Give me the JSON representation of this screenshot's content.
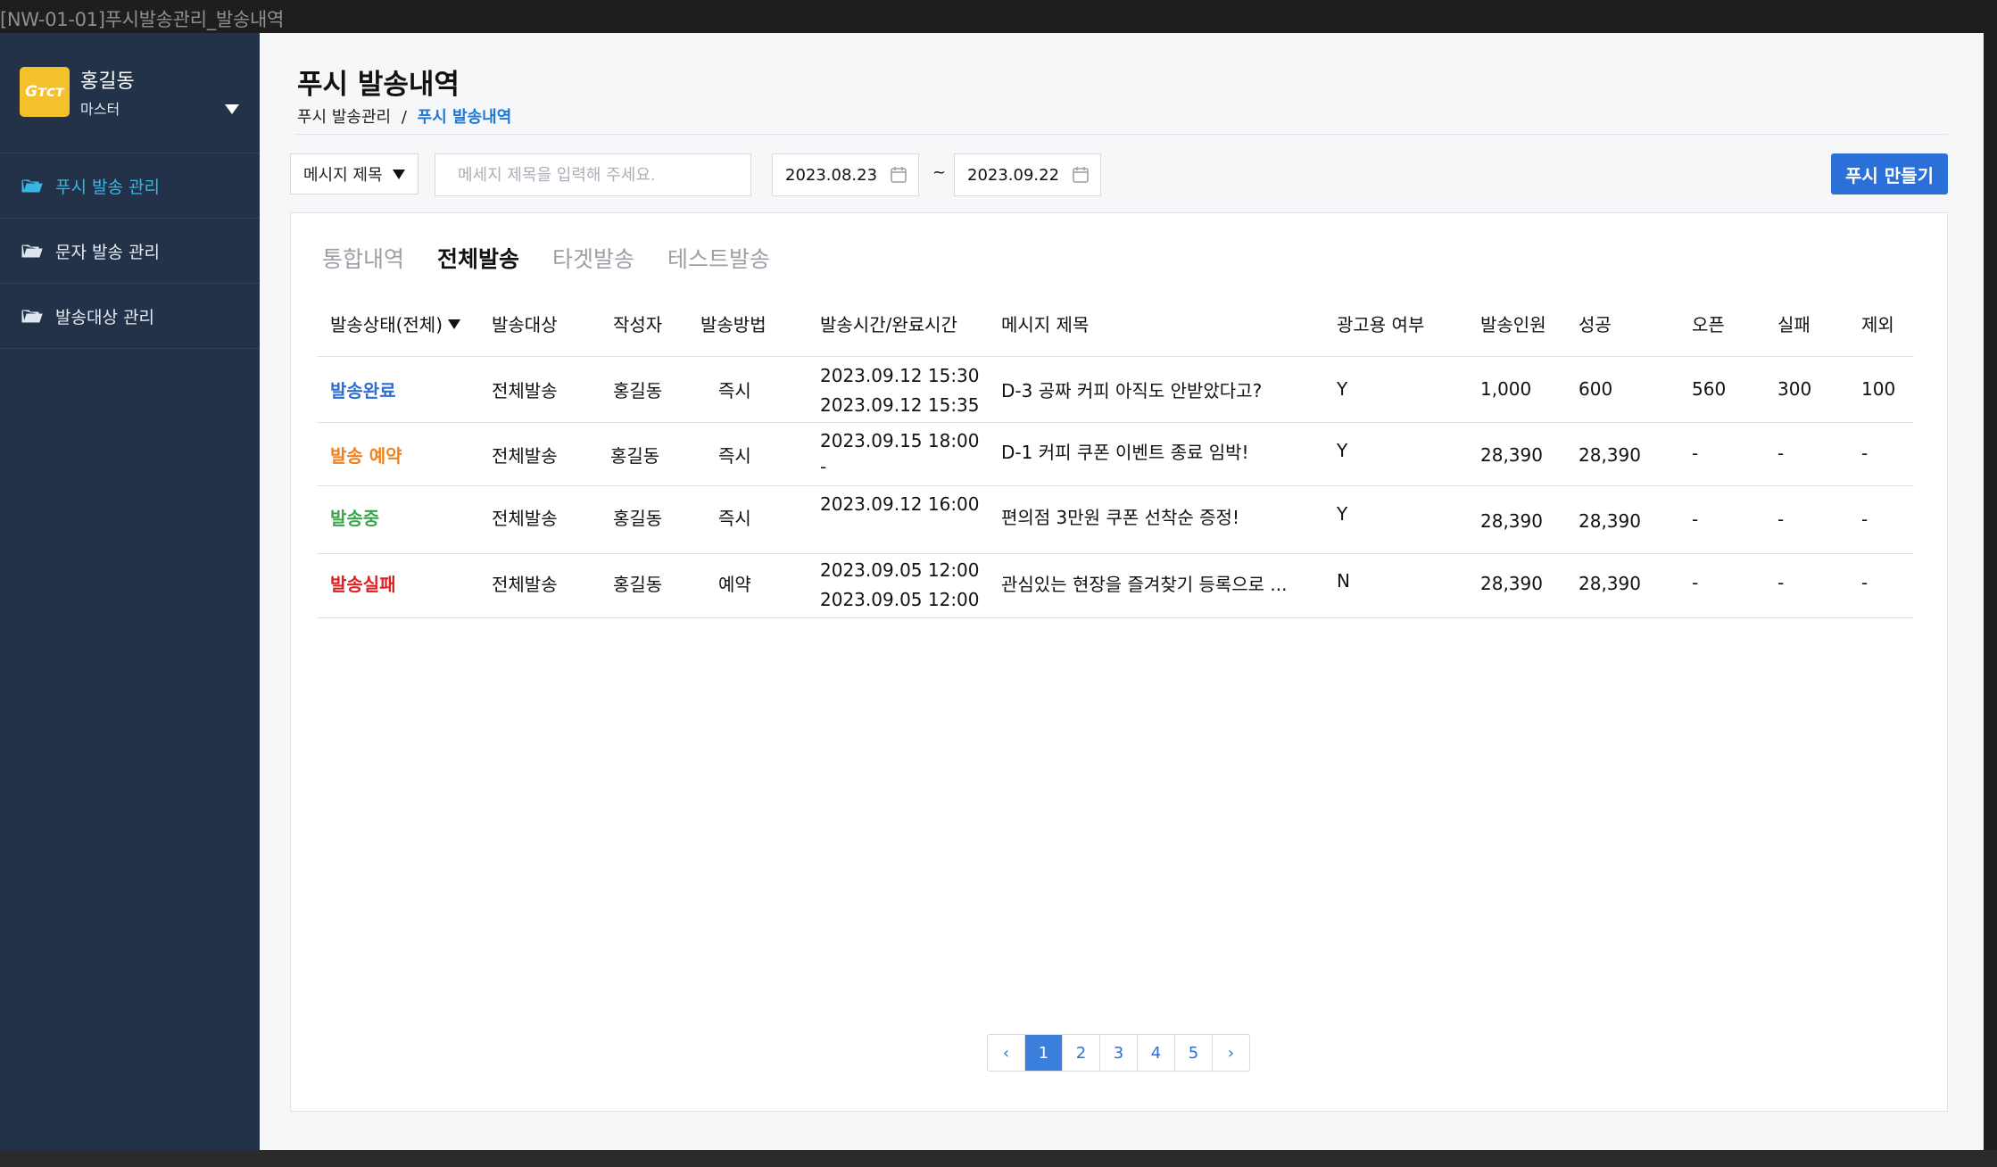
{
  "frame_title": "[NW-01-01]푸시발송관리_발송내역",
  "sidebar": {
    "logo_text": "Gᴛᴄᴛ",
    "user_name": "홍길동",
    "user_role": "마스터",
    "items": [
      {
        "label": "푸시 발송 관리",
        "active": true
      },
      {
        "label": "문자 발송 관리",
        "active": false
      },
      {
        "label": "발송대상 관리",
        "active": false
      }
    ]
  },
  "header": {
    "title": "푸시 발송내역",
    "breadcrumb": {
      "parent": "푸시 발송관리",
      "separator": "/",
      "current": "푸시 발송내역"
    }
  },
  "filters": {
    "select_value": "메시지 제목",
    "search_placeholder": "메세지 제목을 입력해 주세요.",
    "date_from": "2023.08.23",
    "date_to": "2023.09.22",
    "tilde": "~",
    "create_label": "푸시 만들기"
  },
  "tabs": [
    {
      "label": "통합내역",
      "active": false
    },
    {
      "label": "전체발송",
      "active": true
    },
    {
      "label": "타겟발송",
      "active": false
    },
    {
      "label": "테스트발송",
      "active": false
    }
  ],
  "table": {
    "headers": {
      "status": "발송상태(전체)",
      "target": "발송대상",
      "author": "작성자",
      "method": "발송방법",
      "time": "발송시간/완료시간",
      "title": "메시지 제목",
      "ad": "광고용 여부",
      "count": "발송인원",
      "success": "성공",
      "open": "오픈",
      "fail": "실패",
      "exclude": "제외"
    },
    "rows": [
      {
        "status": "발송완료",
        "status_color": "#2f6fd0",
        "target": "전체발송",
        "author": "홍길동",
        "method": "즉시",
        "time1": "2023.09.12 15:30",
        "time2": "2023.09.12 15:35",
        "title": "D-3 공짜 커피 아직도 안받았다고?",
        "ad": "Y",
        "count": "1,000",
        "success": "600",
        "open": "560",
        "fail": "300",
        "exclude": "100"
      },
      {
        "status": "발송 예약",
        "status_color": "#f0821e",
        "target": "전체발송",
        "author": "홍길동",
        "method": "즉시",
        "time1": "2023.09.15 18:00",
        "time2": "-",
        "title": "D-1 커피 쿠폰 이벤트 종료 임박!",
        "ad": "Y",
        "count": "28,390",
        "success": "28,390",
        "open": "-",
        "fail": "-",
        "exclude": "-"
      },
      {
        "status": "발송중",
        "status_color": "#3aa64a",
        "target": "전체발송",
        "author": "홍길동",
        "method": "즉시",
        "time1": "2023.09.12 16:00",
        "time2": "",
        "title": "편의점 3만원 쿠폰 선착순 증정!",
        "ad": "Y",
        "count": "28,390",
        "success": "28,390",
        "open": "-",
        "fail": "-",
        "exclude": "-"
      },
      {
        "status": "발송실패",
        "status_color": "#e02020",
        "target": "전체발송",
        "author": "홍길동",
        "method": "예약",
        "time1": "2023.09.05 12:00",
        "time2": "2023.09.05 12:00",
        "title": "관심있는 현장을 즐겨찾기 등록으로 ...",
        "ad": "N",
        "count": "28,390",
        "success": "28,390",
        "open": "-",
        "fail": "-",
        "exclude": "-"
      }
    ]
  },
  "pagination": {
    "prev": "‹",
    "pages": [
      "1",
      "2",
      "3",
      "4",
      "5"
    ],
    "current": "1",
    "next": "›"
  }
}
